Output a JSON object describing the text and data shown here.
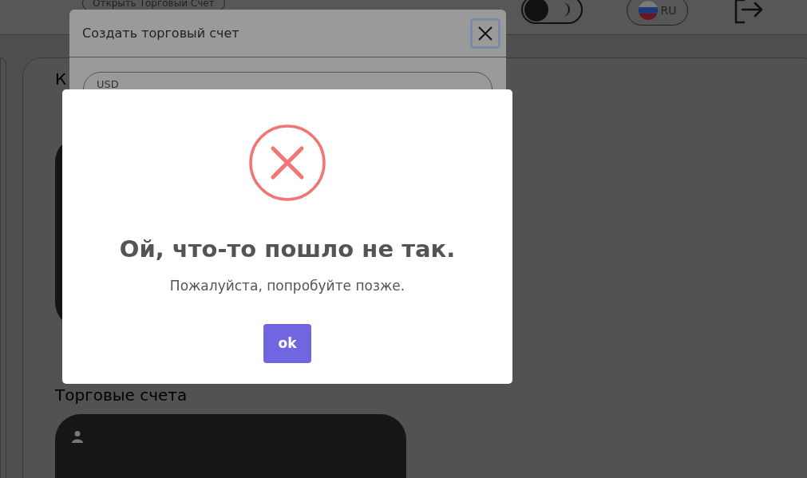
{
  "header": {
    "open_account_button": "Открыть Торговый Счет",
    "theme_toggle": {
      "on": false
    },
    "language": "RU"
  },
  "main": {
    "heading": "К",
    "section_title": "Торговые счета"
  },
  "create_dialog": {
    "title": "Создать торговый счет",
    "currency": "USD"
  },
  "error_dialog": {
    "title": "Ой, что-то пошло не так.",
    "message": "Пожалуйста, попробуйте позже.",
    "button": "ok"
  }
}
